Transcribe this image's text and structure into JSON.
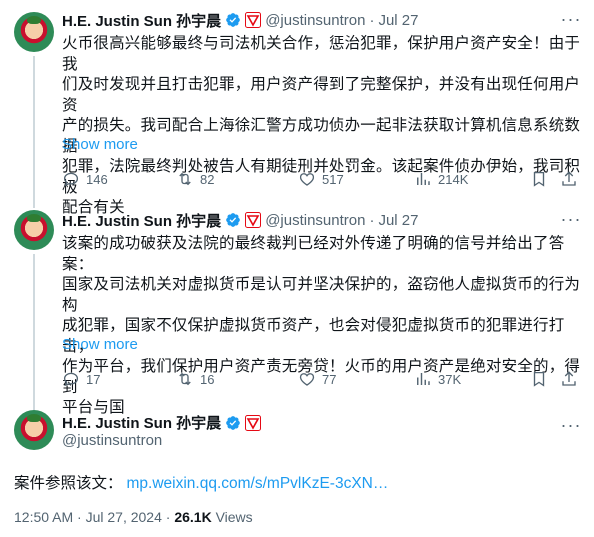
{
  "author": {
    "name": "H.E. Justin Sun 孙宇晨",
    "handle": "@justinsuntron"
  },
  "tweets": [
    {
      "dot": "·",
      "date": "Jul 27",
      "lines": [
        "火币很高兴能够最终与司法机关合作，惩治犯罪，保护用户资产安全！由于我",
        "们及时发现并且打击犯罪，用户资产得到了完整保护，并没有出现任何用户资",
        "产的损失。我司配合上海徐汇警方成功侦办一起非法获取计算机信息系统数据",
        "犯罪，法院最终判处被告人有期徒刑并处罚金。该起案件侦办伊始，我司积极",
        "配合有关"
      ],
      "show_more": "Show more",
      "replies": "146",
      "retweets": "82",
      "likes": "517",
      "views": "214K"
    },
    {
      "dot": "·",
      "date": "Jul 27",
      "lines": [
        "该案的成功破获及法院的最终裁判已经对外传递了明确的信号并给出了答案：",
        "国家及司法机关对虚拟货币是认可并坚决保护的，盗窃他人虚拟货币的行为构",
        "成犯罪，国家不仅保护虚拟货币资产，也会对侵犯虚拟货币的犯罪进行打击，",
        "作为平台，我们保护用户资产责无旁贷！火币的用户资产是绝对安全的，得到",
        "平台与国"
      ],
      "show_more": "Show more",
      "replies": "17",
      "retweets": "16",
      "likes": "77",
      "views": "37K"
    }
  ],
  "main_tweet": {
    "text": "案件参照该文：",
    "link": "mp.weixin.qq.com/s/mPvlKzE-3cXN…",
    "time": "12:50 AM · Jul 27, 2024 ·",
    "views_count": "26.1K",
    "views_label": "Views"
  },
  "icons": {
    "more": "more-dots-icon",
    "reply": "reply-icon",
    "retweet": "retweet-icon",
    "like": "heart-icon",
    "views": "views-chart-icon",
    "bookmark": "bookmark-icon",
    "share": "share-icon",
    "verified": "verified-badge-icon",
    "affiliate": "tron-affiliate-icon"
  },
  "colors": {
    "accent": "#1d9bf0",
    "secondary_text": "#536471",
    "primary_text": "#0f1419",
    "tron_red": "#e50914"
  }
}
